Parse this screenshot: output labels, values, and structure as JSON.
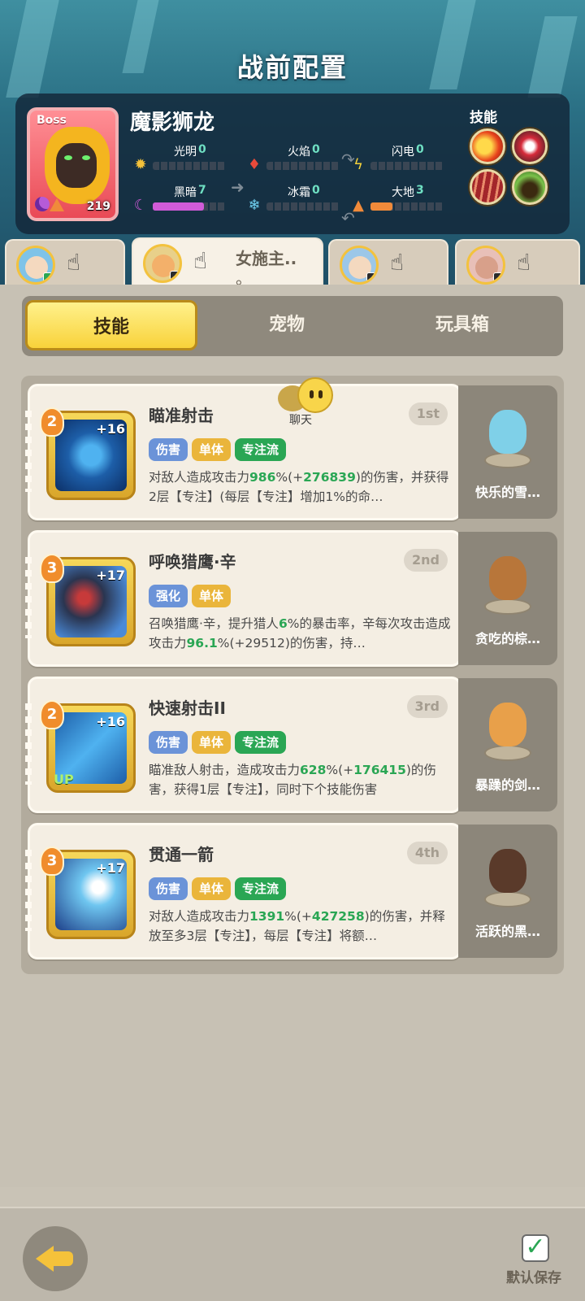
{
  "header": {
    "title": "战前配置"
  },
  "boss": {
    "tag": "Boss",
    "level": "219",
    "name": "魔影狮龙",
    "skills_label": "技能",
    "attributes": [
      {
        "label": "光明",
        "value": "0",
        "icon": "sun-icon",
        "fill": 0,
        "color": "#f5c23a"
      },
      {
        "label": "火焰",
        "value": "0",
        "icon": "fire-icon",
        "fill": 0,
        "color": "#e84a3a"
      },
      {
        "label": "闪电",
        "value": "0",
        "icon": "lightning-icon",
        "fill": 0,
        "color": "#f5d23a"
      },
      {
        "label": "黑暗",
        "value": "7",
        "icon": "moon-icon",
        "fill": 0.7,
        "color": "#d05bd8"
      },
      {
        "label": "冰霜",
        "value": "0",
        "icon": "snowflake-icon",
        "fill": 0,
        "color": "#6fd0f0"
      },
      {
        "label": "大地",
        "value": "3",
        "icon": "earth-icon",
        "fill": 0.3,
        "color": "#f08a3a"
      }
    ]
  },
  "char_tabs": [
    {
      "name": ""
    },
    {
      "name_line1": "女施主..",
      "name_line2": "。"
    },
    {
      "name": ""
    },
    {
      "name": ""
    }
  ],
  "segments": {
    "skills": "技能",
    "pets": "宠物",
    "toys": "玩具箱"
  },
  "chat": {
    "label": "聊天"
  },
  "skills": [
    {
      "name": "瞄准射击",
      "rank": "1st",
      "level": "2",
      "plus": "+16",
      "tags": [
        "伤害",
        "单体",
        "专注流"
      ],
      "desc_pre": "对敌人造成攻击力",
      "desc_hl1": "986",
      "desc_mid1": "%(+",
      "desc_hl2": "276839",
      "desc_post": ")的伤害，并获得2层【专注】(每层【专注】增加1%的命…",
      "pet_name": "快乐的雪…"
    },
    {
      "name": "呼唤猎鹰·辛",
      "rank": "2nd",
      "level": "3",
      "plus": "+17",
      "tags": [
        "强化",
        "单体"
      ],
      "desc_pre": "召唤猎鹰·辛，提升猎人",
      "desc_hl1": "6",
      "desc_mid1": "%的暴击率，辛每次攻击造成攻击力",
      "desc_hl2": "96.1",
      "desc_post": "%(+29512)的伤害，持…",
      "pet_name": "贪吃的棕…"
    },
    {
      "name": "快速射击II",
      "rank": "3rd",
      "level": "2",
      "plus": "+16",
      "tags": [
        "伤害",
        "单体",
        "专注流"
      ],
      "desc_pre": "瞄准敌人射击，造成攻击力",
      "desc_hl1": "628",
      "desc_mid1": "%(+",
      "desc_hl2": "176415",
      "desc_post": ")的伤害，获得1层【专注】，同时下个技能伤害",
      "pet_name": "暴躁的剑…"
    },
    {
      "name": "贯通一箭",
      "rank": "4th",
      "level": "3",
      "plus": "+17",
      "tags": [
        "伤害",
        "单体",
        "专注流"
      ],
      "desc_pre": "对敌人造成攻击力",
      "desc_hl1": "1391",
      "desc_mid1": "%(+",
      "desc_hl2": "427258",
      "desc_post": ")的伤害，并释放至多3层【专注】，每层【专注】将额…",
      "pet_name": "活跃的黑…"
    }
  ],
  "skill_up_label": "UP",
  "footer": {
    "save_label": "默认保存"
  }
}
